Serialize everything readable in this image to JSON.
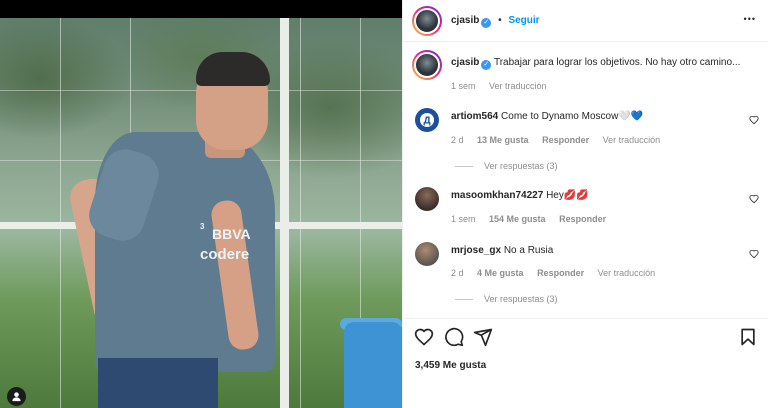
{
  "post": {
    "author": "cjasib",
    "follow_label": "Seguir",
    "more_label": "•••",
    "caption_author": "cjasib",
    "caption_text": "Trabajar para lograr los objetivos. No hay otro camino...",
    "caption_time": "1 sem",
    "caption_translate": "Ver traducción",
    "jersey_sponsor_1": "BBVA",
    "jersey_sponsor_2": "codere",
    "jersey_number": "3"
  },
  "comments": [
    {
      "user": "artiom564",
      "text": "Come to Dynamo Moscow🤍💙",
      "time": "2 d",
      "likes": "13 Me gusta",
      "reply": "Responder",
      "translate": "Ver traducción",
      "avatar": "dynamo-logo",
      "view_replies": "Ver respuestas (3)"
    },
    {
      "user": "masoomkhan74227",
      "text": "Hey💋💋",
      "time": "1 sem",
      "likes": "154 Me gusta",
      "reply": "Responder",
      "avatar": "user-photo"
    },
    {
      "user": "mrjose_gx",
      "text": "No a Rusia",
      "time": "2 d",
      "likes": "4 Me gusta",
      "reply": "Responder",
      "translate": "Ver traducción",
      "avatar": "user-photo",
      "view_replies": "Ver respuestas (3)"
    }
  ],
  "actions": {
    "likes_count": "3,459 Me gusta"
  },
  "colors": {
    "accent": "#0095f6",
    "verified": "#3897f0",
    "text": "#262626",
    "secondary": "#8e8e8e"
  }
}
